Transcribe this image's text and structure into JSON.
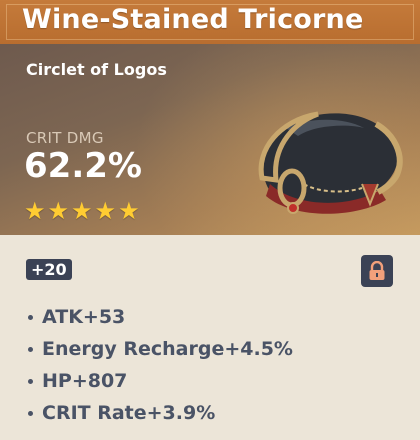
{
  "artifact": {
    "name": "Wine-Stained Tricorne",
    "slot": "Circlet of Logos",
    "main_stat": {
      "label": "CRIT DMG",
      "value": "62.2%"
    },
    "rarity": 5,
    "level": "+20",
    "locked": true,
    "substats": [
      "ATK+53",
      "Energy Recharge+4.5%",
      "HP+807",
      "CRIT Rate+3.9%"
    ]
  },
  "icons": {
    "lock": "lock-icon",
    "star": "star-icon",
    "artifact": "tricorne-hat-icon"
  },
  "colors": {
    "title_bar": "#c57b3b",
    "star": "#ffcc32",
    "badge": "#3b4255",
    "lock_accent": "#f2a07b",
    "text_dark": "#4a5366",
    "background": "#ece5d8"
  }
}
